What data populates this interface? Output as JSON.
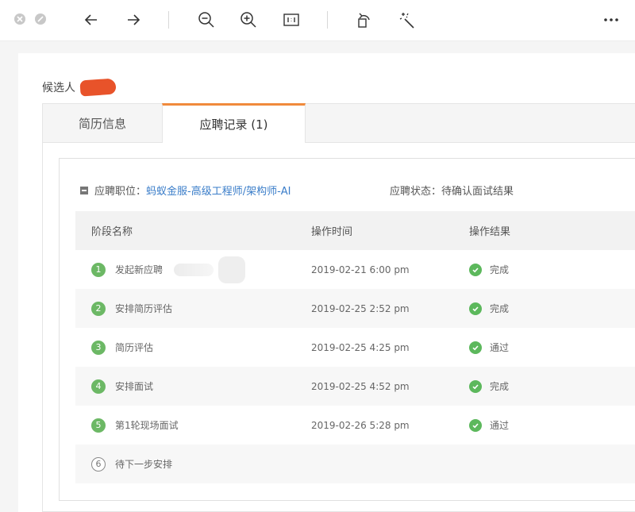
{
  "toolbar": {
    "buttons": [
      "close-icon",
      "stop-icon",
      "back-arrow-icon",
      "forward-arrow-icon",
      "zoom-out-icon",
      "zoom-in-icon",
      "actual-size-icon",
      "rotate-icon",
      "magic-wand-icon",
      "more-icon"
    ]
  },
  "candidate": {
    "label": "候选人"
  },
  "tabs": [
    {
      "label": "简历信息"
    },
    {
      "label": "应聘记录 (1)"
    }
  ],
  "application": {
    "position_label": "应聘职位：",
    "position_value": "蚂蚁金服-高级工程师/架构师-AI",
    "status_label": "应聘状态：",
    "status_value": "待确认面试结果"
  },
  "table": {
    "headers": [
      "阶段名称",
      "操作时间",
      "操作结果"
    ],
    "rows": [
      {
        "num": "1",
        "stage": "发起新应聘",
        "time": "2019-02-21 6:00 pm",
        "result": "完成"
      },
      {
        "num": "2",
        "stage": "安排简历评估",
        "time": "2019-02-25 2:52 pm",
        "result": "完成"
      },
      {
        "num": "3",
        "stage": "简历评估",
        "time": "2019-02-25 4:25 pm",
        "result": "通过"
      },
      {
        "num": "4",
        "stage": "安排面试",
        "time": "2019-02-25 4:52 pm",
        "result": "完成"
      },
      {
        "num": "5",
        "stage": "第1轮现场面试",
        "time": "2019-02-26 5:28 pm",
        "result": "通过"
      },
      {
        "num": "6",
        "stage": "待下一步安排",
        "time": "",
        "result": ""
      }
    ]
  },
  "colors": {
    "accent_tab": "#f08a3c",
    "link": "#3a7dc9",
    "success": "#5cb85c",
    "redaction": "#e8532a"
  }
}
